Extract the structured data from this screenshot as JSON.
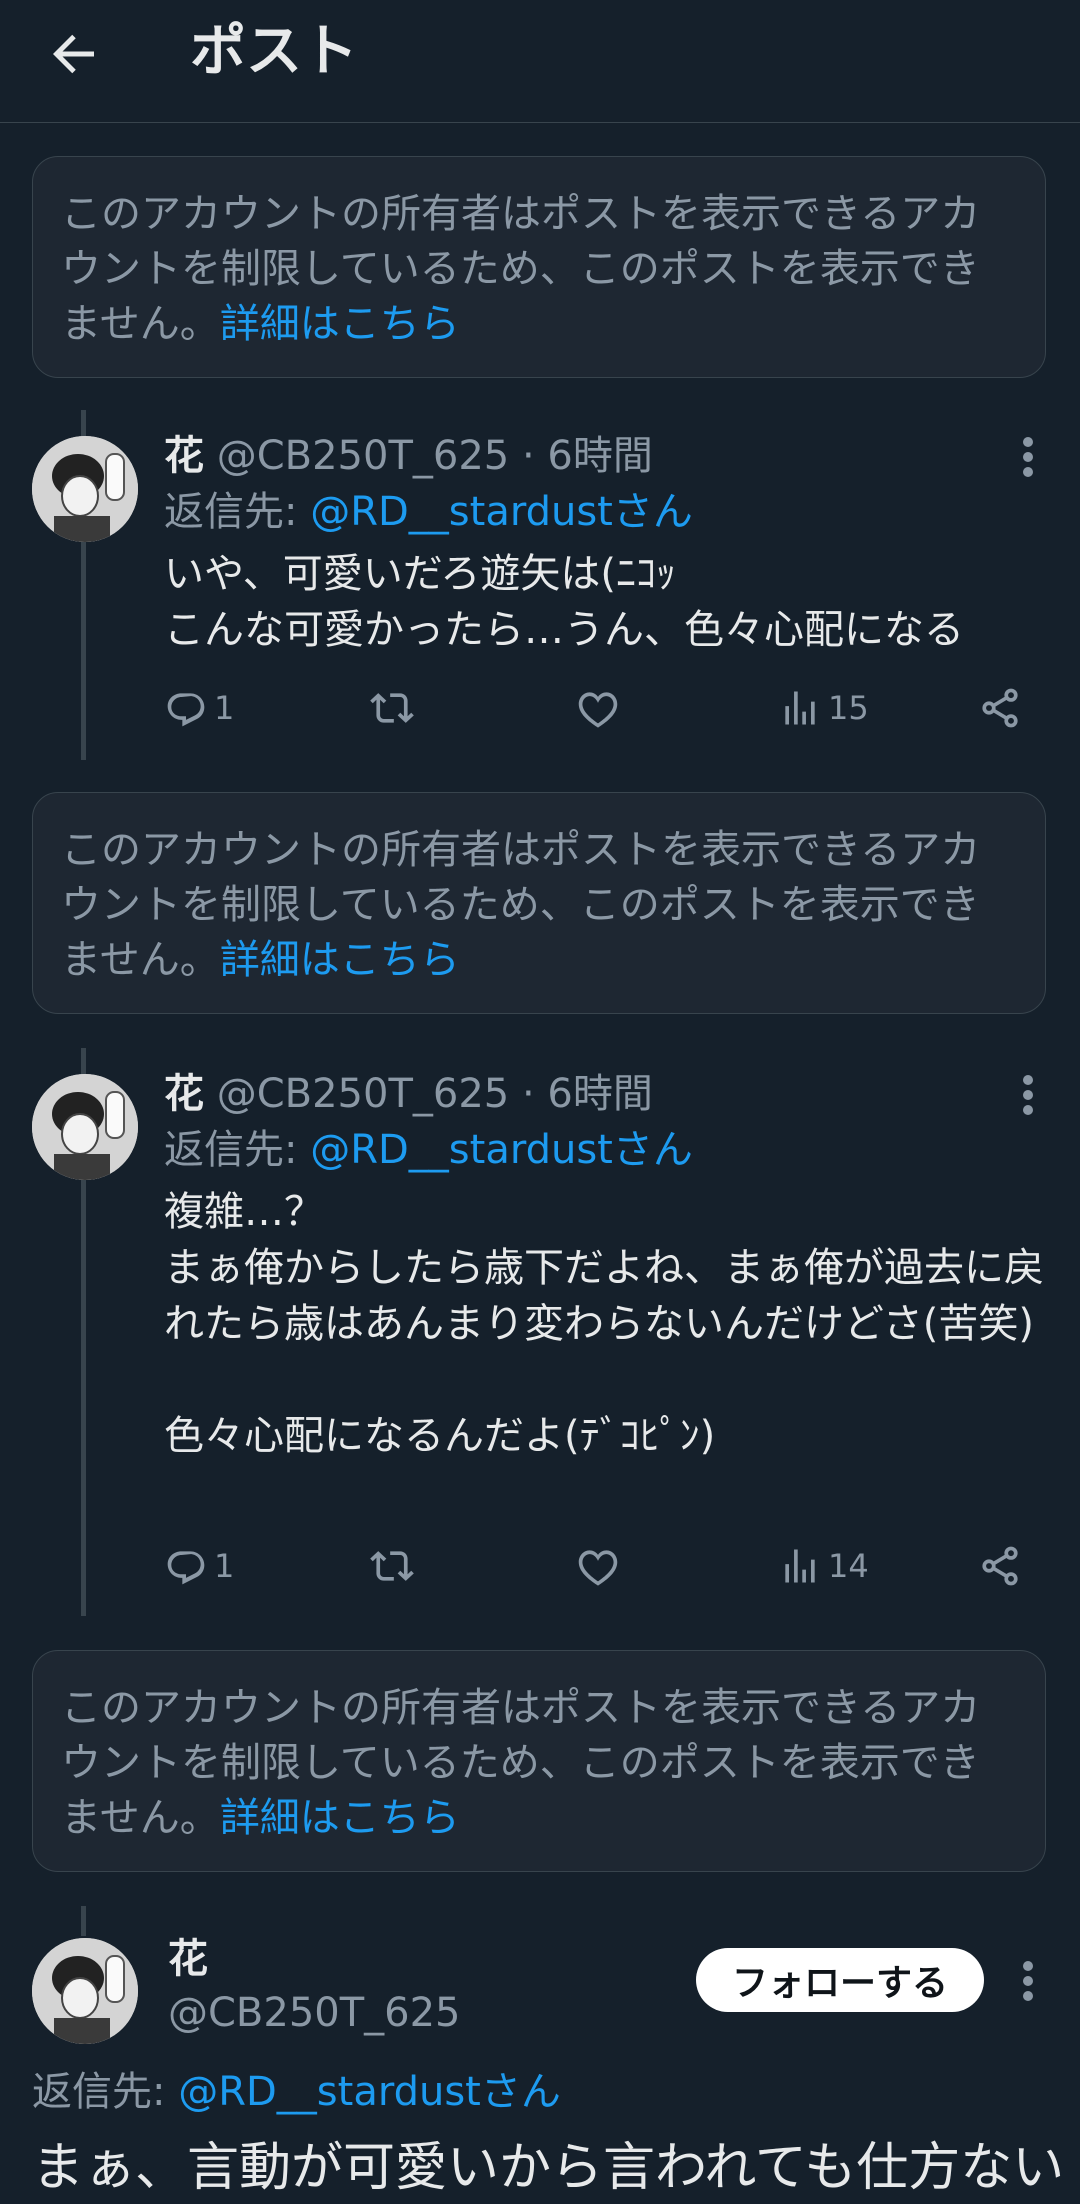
{
  "header": {
    "title": "ポスト"
  },
  "restricted_notice": {
    "text": "このアカウントの所有者はポストを表示できるアカウントを制限しているため、このポストを表示できません。",
    "link": "詳細はこちら"
  },
  "tweets": [
    {
      "name": "花",
      "handle": "@CB250T_625",
      "separator": "·",
      "time": "6時間",
      "reply_prefix": "返信先: ",
      "reply_to": "@RD__stardustさん",
      "text": "いや、可愛いだろ遊矢は(ﾆｺｯ\nこんな可愛かったら…うん、色々心配になる",
      "replies": "1",
      "views": "15"
    },
    {
      "name": "花",
      "handle": "@CB250T_625",
      "separator": "·",
      "time": "6時間",
      "reply_prefix": "返信先: ",
      "reply_to": "@RD__stardustさん",
      "text": "複雑…？\nまぁ俺からしたら歳下だよね、まぁ俺が過去に戻れたら歳はあんまり変わらないんだけどさ(苦笑)\n\n色々心配になるんだよ(ﾃﾞｺﾋﾟﾝ)",
      "replies": "1",
      "views": "14"
    }
  ],
  "focused_post": {
    "name": "花",
    "handle": "@CB250T_625",
    "follow_label": "フォローする",
    "reply_prefix": "返信先: ",
    "reply_to": "@RD__stardustさん",
    "text_partial": "まぁ、言動が可愛いから言われても仕方ない"
  },
  "colors": {
    "background": "#15202b",
    "accent": "#1d9bf0",
    "muted": "#8b98a5",
    "card": "#1e2732"
  },
  "icons": [
    "back-arrow-icon",
    "more-icon",
    "reply-icon",
    "retweet-icon",
    "like-icon",
    "views-icon",
    "share-icon"
  ]
}
